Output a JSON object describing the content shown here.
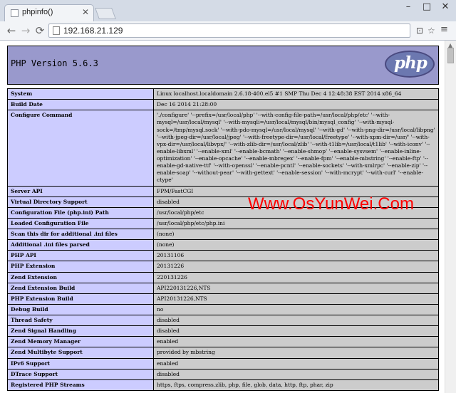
{
  "browser": {
    "tab_title": "phpinfo()",
    "url": "192.168.21.129",
    "new_tab_label": "",
    "window_buttons": {
      "minimize": "–",
      "maximize": "□",
      "close": "✕"
    },
    "nav": {
      "back": "←",
      "forward": "→",
      "reload": "⟳"
    },
    "toolbar_icons": {
      "translate": "⊡",
      "star": "☆",
      "menu": "≡"
    }
  },
  "page": {
    "version_title": "PHP Version 5.6.3",
    "logo_text": "php",
    "watermark": "Www.OsYunWei.Com",
    "rows": [
      {
        "key": "System",
        "value": "Linux localhost.localdomain 2.6.18-400.el5 #1 SMP Thu Dec 4 12:48:38 EST 2014 x86_64"
      },
      {
        "key": "Build Date",
        "value": "Dec 16 2014 21:28:00"
      },
      {
        "key": "Configure Command",
        "value": "'./configure' '--prefix=/usr/local/php' '--with-config-file-path=/usr/local/php/etc' '--with-mysql=/usr/local/mysql' '--with-mysqli=/usr/local/mysql/bin/mysql_config' '--with-mysql-sock=/tmp/mysql.sock' '--with-pdo-mysql=/usr/local/mysql' '--with-gd' '--with-png-dir=/usr/local/libpng' '--with-jpeg-dir=/usr/local/jpeg' '--with-freetype-dir=/usr/local/freetype' '--with-xpm-dir=/usr/' '--with-vpx-dir=/usr/local/libvpx/' '--with-zlib-dir=/usr/local/zlib' '--with-t1lib=/usr/local/t1lib' '--with-iconv' '--enable-libxml' '--enable-xml' '--enable-bcmath' '--enable-shmop' '--enable-sysvsem' '--enable-inline-optimization' '--enable-opcache' '--enable-mbregex' '--enable-fpm' '--enable-mbstring' '--enable-ftp' '--enable-gd-native-ttf' '--with-openssl' '--enable-pcntl' '--enable-sockets' '--with-xmlrpc' '--enable-zip' '--enable-soap' '--without-pear' '--with-gettext' '--enable-session' '--with-mcrypt' '--with-curl' '--enable-ctype'"
      },
      {
        "key": "Server API",
        "value": "FPM/FastCGI"
      },
      {
        "key": "Virtual Directory Support",
        "value": "disabled"
      },
      {
        "key": "Configuration File (php.ini) Path",
        "value": "/usr/local/php/etc"
      },
      {
        "key": "Loaded Configuration File",
        "value": "/usr/local/php/etc/php.ini"
      },
      {
        "key": "Scan this dir for additional .ini files",
        "value": "(none)"
      },
      {
        "key": "Additional .ini files parsed",
        "value": "(none)"
      },
      {
        "key": "PHP API",
        "value": "20131106"
      },
      {
        "key": "PHP Extension",
        "value": "20131226"
      },
      {
        "key": "Zend Extension",
        "value": "220131226"
      },
      {
        "key": "Zend Extension Build",
        "value": "API220131226,NTS"
      },
      {
        "key": "PHP Extension Build",
        "value": "API20131226,NTS"
      },
      {
        "key": "Debug Build",
        "value": "no"
      },
      {
        "key": "Thread Safety",
        "value": "disabled"
      },
      {
        "key": "Zend Signal Handling",
        "value": "disabled"
      },
      {
        "key": "Zend Memory Manager",
        "value": "enabled"
      },
      {
        "key": "Zend Multibyte Support",
        "value": "provided by mbstring"
      },
      {
        "key": "IPv6 Support",
        "value": "enabled"
      },
      {
        "key": "DTrace Support",
        "value": "disabled"
      },
      {
        "key": "Registered PHP Streams",
        "value": "https, ftps, compress.zlib, php, file, glob, data, http, ftp, phar, zip"
      }
    ]
  }
}
